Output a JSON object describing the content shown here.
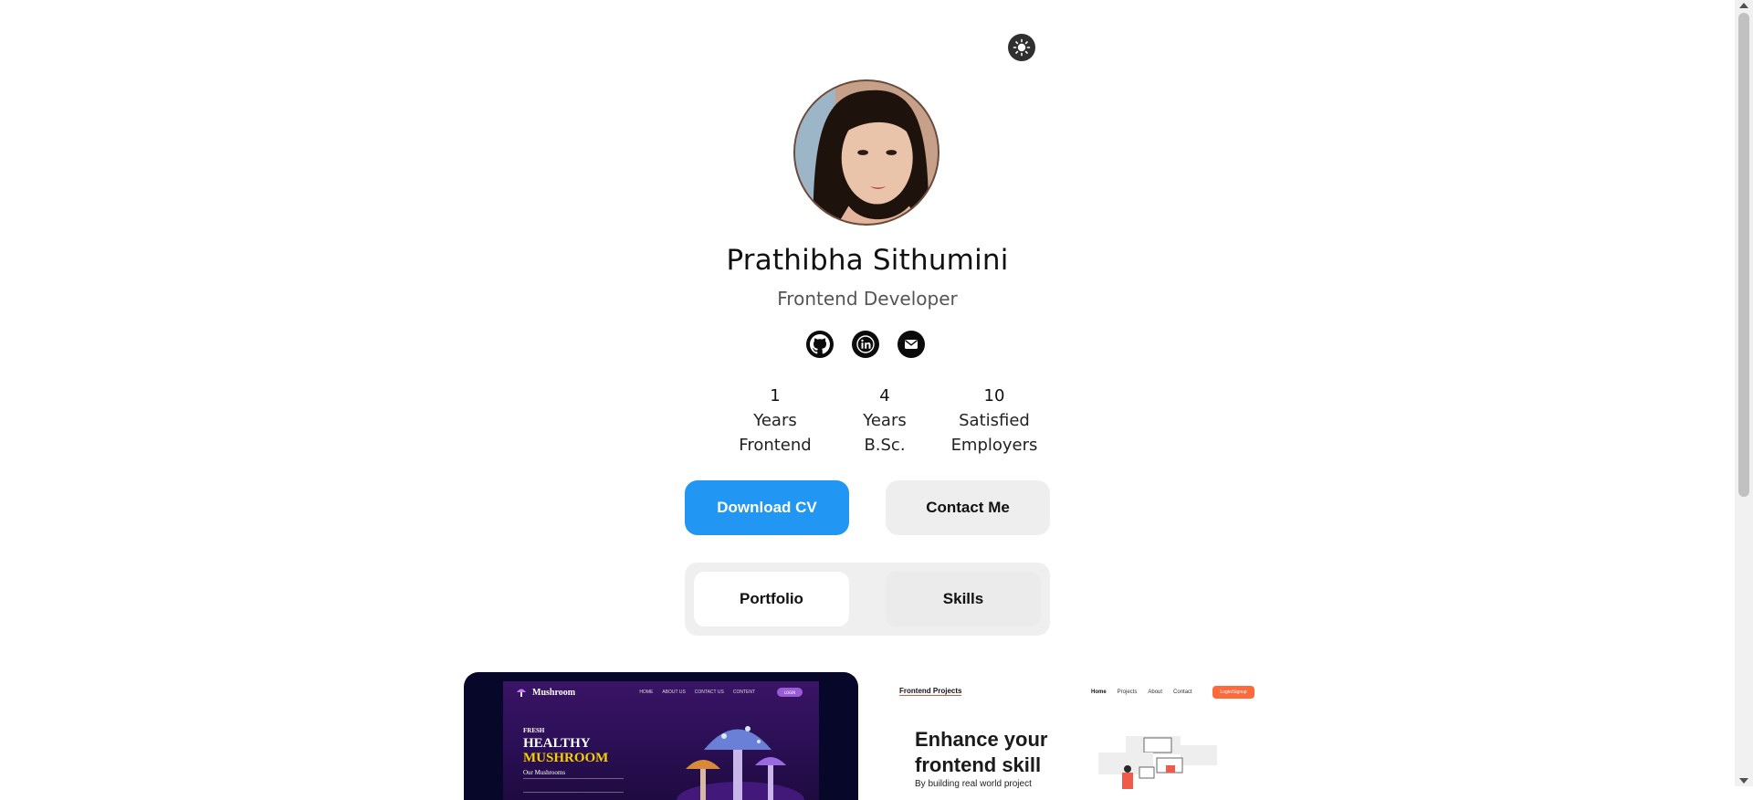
{
  "profile": {
    "name": "Prathibha Sithumini",
    "role": "Frontend Developer"
  },
  "theme_toggle": {
    "icon": "sun-icon"
  },
  "socials": [
    {
      "name": "github",
      "icon": "github-icon"
    },
    {
      "name": "linkedin",
      "icon": "linkedin-icon"
    },
    {
      "name": "email",
      "icon": "mail-icon"
    }
  ],
  "stats": [
    {
      "value": "1",
      "line1": "Years",
      "line2": "Frontend"
    },
    {
      "value": "4",
      "line1": "Years",
      "line2": "B.Sc."
    },
    {
      "value": "10",
      "line1": "Satisfied",
      "line2": "Employers"
    }
  ],
  "buttons": {
    "download_cv": "Download CV",
    "contact_me": "Contact Me"
  },
  "tabs": {
    "portfolio": "Portfolio",
    "skills": "Skills",
    "active": "Portfolio"
  },
  "portfolio": {
    "mushroom": {
      "logo": "Mushroom",
      "nav": [
        "HOME",
        "ABOUT US",
        "CONTACT US",
        "CONTENT"
      ],
      "nav_button": "LOGIN",
      "eyebrow": "FRESH",
      "headline_1": "HEALTHY",
      "headline_2": "MUSHROOM",
      "subhead": "Our Mushrooms"
    },
    "frontend_projects": {
      "logo": "Frontend Projects",
      "nav": [
        "Home",
        "Projects",
        "About",
        "Contact"
      ],
      "nav_button": "Login/Signup",
      "headline_1": "Enhance your",
      "headline_2": "frontend skill",
      "subtext": "By building real world project"
    }
  },
  "colors": {
    "primary": "#2196f3",
    "secondary_bg": "#eeeeee",
    "tab_bg": "#efefef",
    "accent_orange": "#ff6a3d",
    "mushroom_yellow": "#f5d000"
  }
}
